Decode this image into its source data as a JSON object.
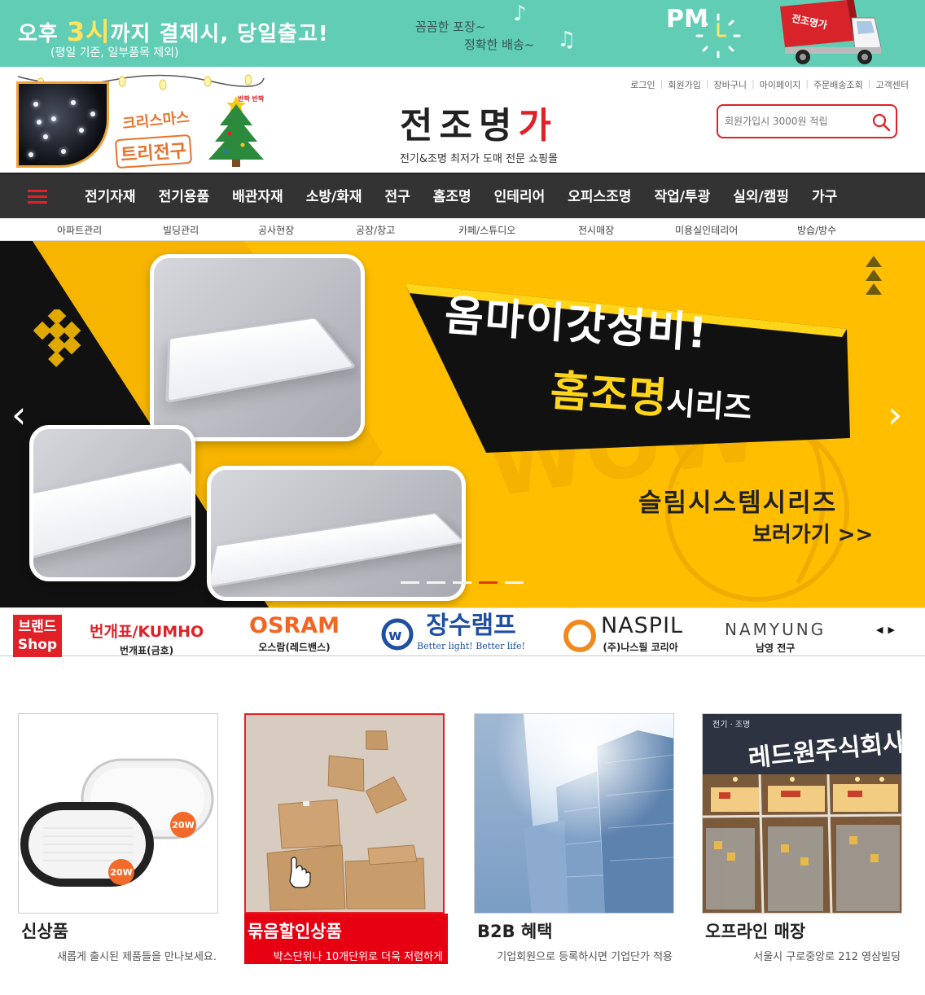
{
  "promo": {
    "main_prefix": "오후 ",
    "main_highlight": "3시",
    "main_suffix": "까지 결제시, 당일출고!",
    "sub": "(평일 기준, 일부품목 제외)",
    "mid_line1": "꼼꼼한 포장~",
    "mid_line2": "정확한 배송~",
    "pm": "PM",
    "truck_label": "전조명가"
  },
  "header": {
    "xmas_line1": "크리스마스",
    "xmas_line2": "트리전구",
    "xmas_tree_text": "반짝 반짝",
    "logo_main": "전조명",
    "logo_red": "가",
    "logo_tagline": "전기&조명 최저가 도매 전문 쇼핑몰",
    "util_links": [
      "로그인",
      "회원가입",
      "장바구니",
      "마이페이지",
      "주문배송조회",
      "고객센터"
    ],
    "search_placeholder": "회원가입시 3000원 적립"
  },
  "nav": {
    "items": [
      "전기자재",
      "전기용품",
      "배관자재",
      "소방/화재",
      "전구",
      "홈조명",
      "인테리어",
      "오피스조명",
      "작업/투광",
      "실외/캠핑",
      "가구"
    ],
    "sub_items": [
      "아파트관리",
      "빌딩관리",
      "공사현장",
      "공장/창고",
      "카페/스튜디오",
      "전시매장",
      "미용실인테리어",
      "방습/방수"
    ]
  },
  "banner": {
    "headline": "옴마이갓성비!",
    "series_main": "홈조명",
    "series_small": "시리즈",
    "slim": "슬림시스템시리즈",
    "goto": "보러가기 >>",
    "prev": "‹",
    "next": "›",
    "slide_count": 5,
    "active_slide": 4
  },
  "brands": {
    "shop_line1": "브랜드",
    "shop_line2": "Shop",
    "items": [
      {
        "mark": "번개표/KUMHO",
        "caption": "번개표(금호)",
        "color": "#e02128"
      },
      {
        "mark": "OSRAM",
        "caption": "오스람(레드밴스)",
        "color": "#f26522"
      },
      {
        "mark": "장수램프",
        "caption": "Better light! Better life!",
        "color": "#1f4ea3"
      },
      {
        "mark": "NASPIL",
        "caption": "(주)나스필 코리아",
        "color": "#222222"
      },
      {
        "mark": "NAMYUNG",
        "caption": "남영 전구",
        "color": "#444444"
      }
    ],
    "pager": "◀▶"
  },
  "cards": [
    {
      "title": "신상품",
      "desc": "새롭게 출시된 제품들을 만나보세요.",
      "badge1": "20W",
      "badge2": "20W"
    },
    {
      "title": "묶음할인상품",
      "desc": "박스단위나 10개단위로 더욱 저렴하게"
    },
    {
      "title": "B2B 혜택",
      "desc": "기업회원으로 등록하시면 기업단가 적용"
    },
    {
      "title": "오프라인 매장",
      "desc": "서울시 구로중앙로 212 영삼빌딩",
      "store_sign": "레드원주식회사",
      "store_small": "전기 · 조명"
    }
  ],
  "colors": {
    "accent_red": "#e02128",
    "promo_bg": "#61cdb5",
    "nav_bg": "#333333",
    "banner_yellow": "#ffbf00"
  }
}
